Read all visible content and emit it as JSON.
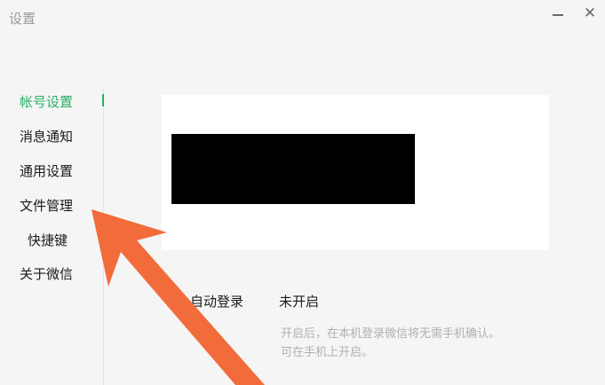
{
  "window": {
    "title": "设置",
    "minimize_icon": "minimize-icon",
    "close_icon": "close-icon",
    "close_glyph": "✕"
  },
  "sidebar": {
    "active_color": "#2aae67",
    "items": [
      {
        "label": "帐号设置",
        "active": true
      },
      {
        "label": "消息通知",
        "active": false
      },
      {
        "label": "通用设置",
        "active": false
      },
      {
        "label": "文件管理",
        "active": false
      },
      {
        "label": "快捷键",
        "active": false
      },
      {
        "label": "关于微信",
        "active": false
      }
    ]
  },
  "main": {
    "auto_login": {
      "label": "自动登录",
      "value": "未开启",
      "hint_line1": "开启后，在本机登录微信将无需手机确认。",
      "hint_line2": "可在手机上开启。"
    }
  },
  "annotation": {
    "arrow_color": "#f26b3a",
    "arrow_icon": "arrow-annotation-icon"
  }
}
